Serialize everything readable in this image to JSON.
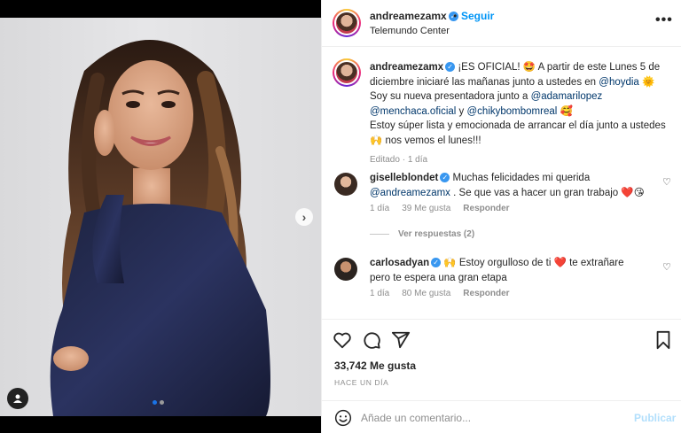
{
  "post": {
    "username": "andreamezamx",
    "separator": "•",
    "follow_label": "Seguir",
    "location": "Telemundo Center",
    "more_label": "•••"
  },
  "caption": {
    "username": "andreamezamx",
    "line1": "¡ES OFICIAL! 🤩 A partir de este Lunes 5 de diciembre iniciaré las mañanas junto a ustedes en",
    "mention_hoydia": "@hoydia",
    "line1_end": "🌞",
    "line2": "Soy su nueva presentadora junto a",
    "mention_ada": "@adamarilopez",
    "mention_menchaca": "@menchaca.oficial",
    "conj": "y",
    "mention_chiky": "@chikybombomreal",
    "line2_end": "🥰",
    "line3": "Estoy súper lista y emocionada de arrancar el día junto a ustedes 🙌 nos vemos el lunes!!!",
    "edited": "Editado",
    "edited_sep": "·",
    "age": "1 día"
  },
  "comments": [
    {
      "username": "giselleblondet",
      "text_a": "Muchas felicidades mi querida",
      "mention": "@andreamezamx",
      "text_b": ". Se que vas a hacer un gran trabajo ❤️😘",
      "age": "1 día",
      "likes": "39 Me gusta",
      "reply": "Responder",
      "heart": "♡"
    },
    {
      "username": "carlosadyan",
      "text_a": "🙌 Estoy orgulloso de ti ❤️ te extrañare pero te espera una gran etapa",
      "age": "1 día",
      "likes": "80 Me gusta",
      "reply": "Responder",
      "heart": "♡"
    }
  ],
  "see_replies": "Ver respuestas (2)",
  "likes_count": "33,742 Me gusta",
  "timestamp": "HACE UN DÍA",
  "add_comment": {
    "placeholder": "Añade un comentario...",
    "post_label": "Publicar"
  },
  "carousel": {
    "next_label": "›"
  },
  "icons": {
    "heart": "heart-icon",
    "comment": "comment-icon",
    "share": "share-icon",
    "save": "bookmark-icon",
    "emoji": "emoji-icon",
    "tag": "user-tag-icon"
  },
  "colors": {
    "accent": "#0095f6",
    "verified": "#3897f0",
    "text": "#262626",
    "muted": "#8e8e8e",
    "link": "#00376b"
  }
}
